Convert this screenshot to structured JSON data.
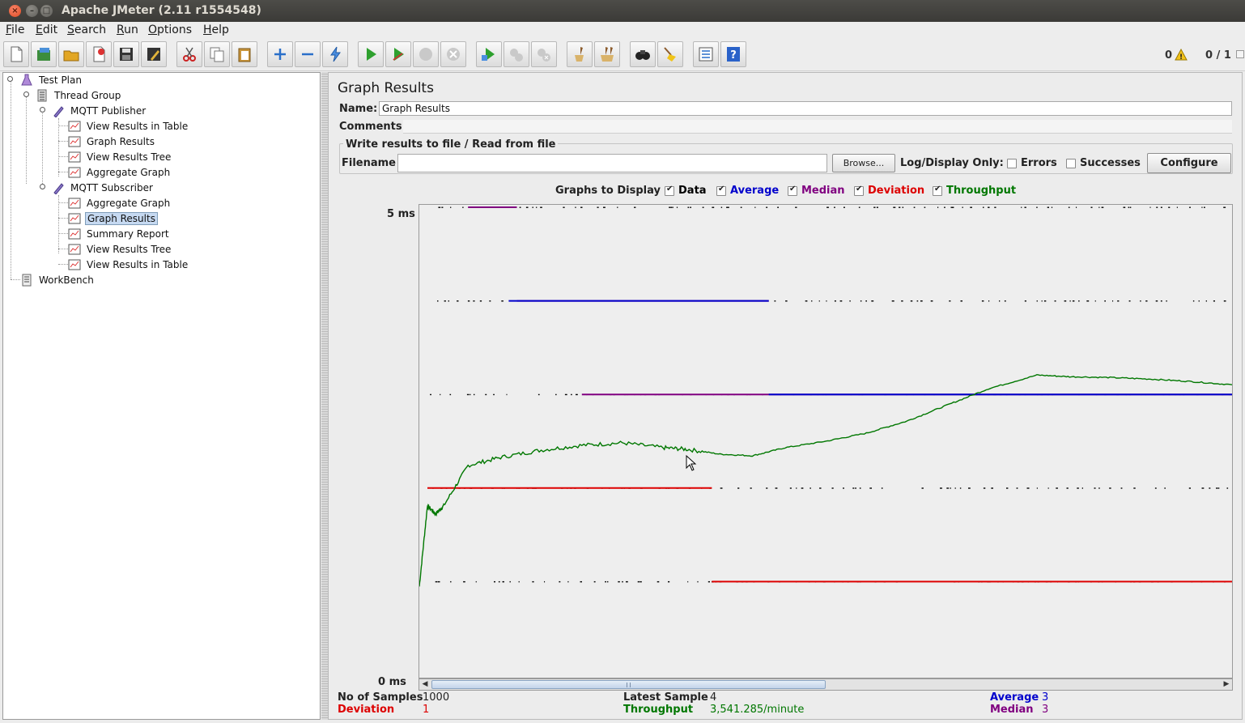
{
  "window": {
    "title": "Apache JMeter (2.11 r1554548)"
  },
  "menu": [
    {
      "label": "File",
      "mnemonic": "F"
    },
    {
      "label": "Edit",
      "mnemonic": "E"
    },
    {
      "label": "Search",
      "mnemonic": "S"
    },
    {
      "label": "Run",
      "mnemonic": "R"
    },
    {
      "label": "Options",
      "mnemonic": "O"
    },
    {
      "label": "Help",
      "mnemonic": "H"
    }
  ],
  "toolbar": {
    "buttons": [
      "new-icon",
      "templates-icon",
      "open-icon",
      "close-icon",
      "save-icon",
      "save-as-icon",
      "cut-icon",
      "copy-icon",
      "paste-icon",
      "expand-icon",
      "collapse-icon",
      "toggle-icon",
      "start-icon",
      "start-no-pause-icon",
      "stop-icon",
      "shutdown-icon",
      "remote-start-icon",
      "remote-stop-icon",
      "remote-shutdown-icon",
      "clear-icon",
      "clear-all-icon",
      "search-icon",
      "reset-search-icon",
      "function-helper-icon",
      "help-icon"
    ],
    "warning_count": "0",
    "threads": "0 / 1"
  },
  "tree": {
    "nodes": [
      {
        "label": "Test Plan",
        "icon": "test-plan-icon"
      },
      {
        "label": "Thread Group",
        "icon": "thread-group-icon"
      },
      {
        "label": "MQTT Publisher",
        "icon": "sampler-icon"
      },
      {
        "label": "View Results in Table",
        "icon": "listener-icon"
      },
      {
        "label": "Graph Results",
        "icon": "listener-icon"
      },
      {
        "label": "View Results Tree",
        "icon": "listener-icon"
      },
      {
        "label": "Aggregate Graph",
        "icon": "listener-icon"
      },
      {
        "label": "MQTT Subscriber",
        "icon": "sampler-icon"
      },
      {
        "label": "Aggregate Graph",
        "icon": "listener-icon"
      },
      {
        "label": "Graph Results",
        "icon": "listener-icon",
        "selected": true
      },
      {
        "label": "Summary Report",
        "icon": "listener-icon"
      },
      {
        "label": "View Results Tree",
        "icon": "listener-icon"
      },
      {
        "label": "View Results in Table",
        "icon": "listener-icon"
      },
      {
        "label": "WorkBench",
        "icon": "workbench-icon"
      }
    ]
  },
  "panel": {
    "title": "Graph Results",
    "name_label": "Name:",
    "name_value": "Graph Results",
    "comments_label": "Comments:",
    "comments_value": "",
    "file_box_title": "Write results to file / Read from file",
    "filename_label": "Filename",
    "filename_value": "",
    "browse_label": "Browse...",
    "log_display_label": "Log/Display Only:",
    "errors_label": "Errors",
    "errors_checked": false,
    "successes_label": "Successes",
    "successes_checked": false,
    "configure_label": "Configure",
    "graphs_to_display_label": "Graphs to Display",
    "graph_toggles": [
      {
        "label": "Data",
        "checked": true,
        "color": "#000000"
      },
      {
        "label": "Average",
        "checked": true,
        "color": "#0000cc"
      },
      {
        "label": "Median",
        "checked": true,
        "color": "#800080"
      },
      {
        "label": "Deviation",
        "checked": true,
        "color": "#dd0000"
      },
      {
        "label": "Throughput",
        "checked": true,
        "color": "#007700"
      }
    ]
  },
  "chart_data": {
    "type": "line",
    "ylim": [
      0,
      5
    ],
    "y_unit": "ms",
    "y_ticks": [
      "5 ms",
      "0 ms"
    ],
    "data_levels_ms": [
      5,
      4,
      3,
      2,
      1
    ],
    "average": [
      {
        "x_frac_range": [
          0.11,
          0.43
        ],
        "y": 4
      },
      {
        "x_frac_range": [
          0.43,
          1.0
        ],
        "y": 3
      }
    ],
    "median": [
      {
        "x_frac_range": [
          0.06,
          0.12
        ],
        "y": 5
      },
      {
        "x_frac_range": [
          0.12,
          0.43
        ],
        "y": 4
      },
      {
        "x_frac_range": [
          0.2,
          1.0
        ],
        "y": 3
      }
    ],
    "deviation": [
      {
        "x_frac_range": [
          0.01,
          0.36
        ],
        "y": 2
      },
      {
        "x_frac_range": [
          0.36,
          1.0
        ],
        "y": 1
      }
    ],
    "throughput_per_minute": [
      {
        "x": 0.0,
        "y": 1100
      },
      {
        "x": 0.01,
        "y": 2100
      },
      {
        "x": 0.02,
        "y": 2000
      },
      {
        "x": 0.03,
        "y": 2100
      },
      {
        "x": 0.06,
        "y": 2600
      },
      {
        "x": 0.1,
        "y": 2700
      },
      {
        "x": 0.15,
        "y": 2790
      },
      {
        "x": 0.2,
        "y": 2850
      },
      {
        "x": 0.25,
        "y": 2880
      },
      {
        "x": 0.3,
        "y": 2820
      },
      {
        "x": 0.33,
        "y": 2800
      },
      {
        "x": 0.37,
        "y": 2740
      },
      {
        "x": 0.41,
        "y": 2720
      },
      {
        "x": 0.45,
        "y": 2820
      },
      {
        "x": 0.5,
        "y": 2900
      },
      {
        "x": 0.55,
        "y": 3000
      },
      {
        "x": 0.6,
        "y": 3150
      },
      {
        "x": 0.65,
        "y": 3350
      },
      {
        "x": 0.7,
        "y": 3550
      },
      {
        "x": 0.76,
        "y": 3720
      },
      {
        "x": 0.8,
        "y": 3700
      },
      {
        "x": 0.85,
        "y": 3690
      },
      {
        "x": 0.9,
        "y": 3670
      },
      {
        "x": 0.95,
        "y": 3640
      },
      {
        "x": 1.0,
        "y": 3600
      }
    ],
    "throughput_ylim": [
      0,
      5800
    ]
  },
  "stats": {
    "samples_label": "No of Samples",
    "samples_value": "1000",
    "latest_label": "Latest Sample",
    "latest_value": "4",
    "average_label": "Average",
    "average_value": "3",
    "deviation_label": "Deviation",
    "deviation_value": "1",
    "throughput_label": "Throughput",
    "throughput_value": "3,541.285/minute",
    "median_label": "Median",
    "median_value": "3"
  },
  "colors": {
    "data": "#000000",
    "average": "#0000cc",
    "median": "#800080",
    "deviation": "#dd0000",
    "throughput": "#007700"
  }
}
